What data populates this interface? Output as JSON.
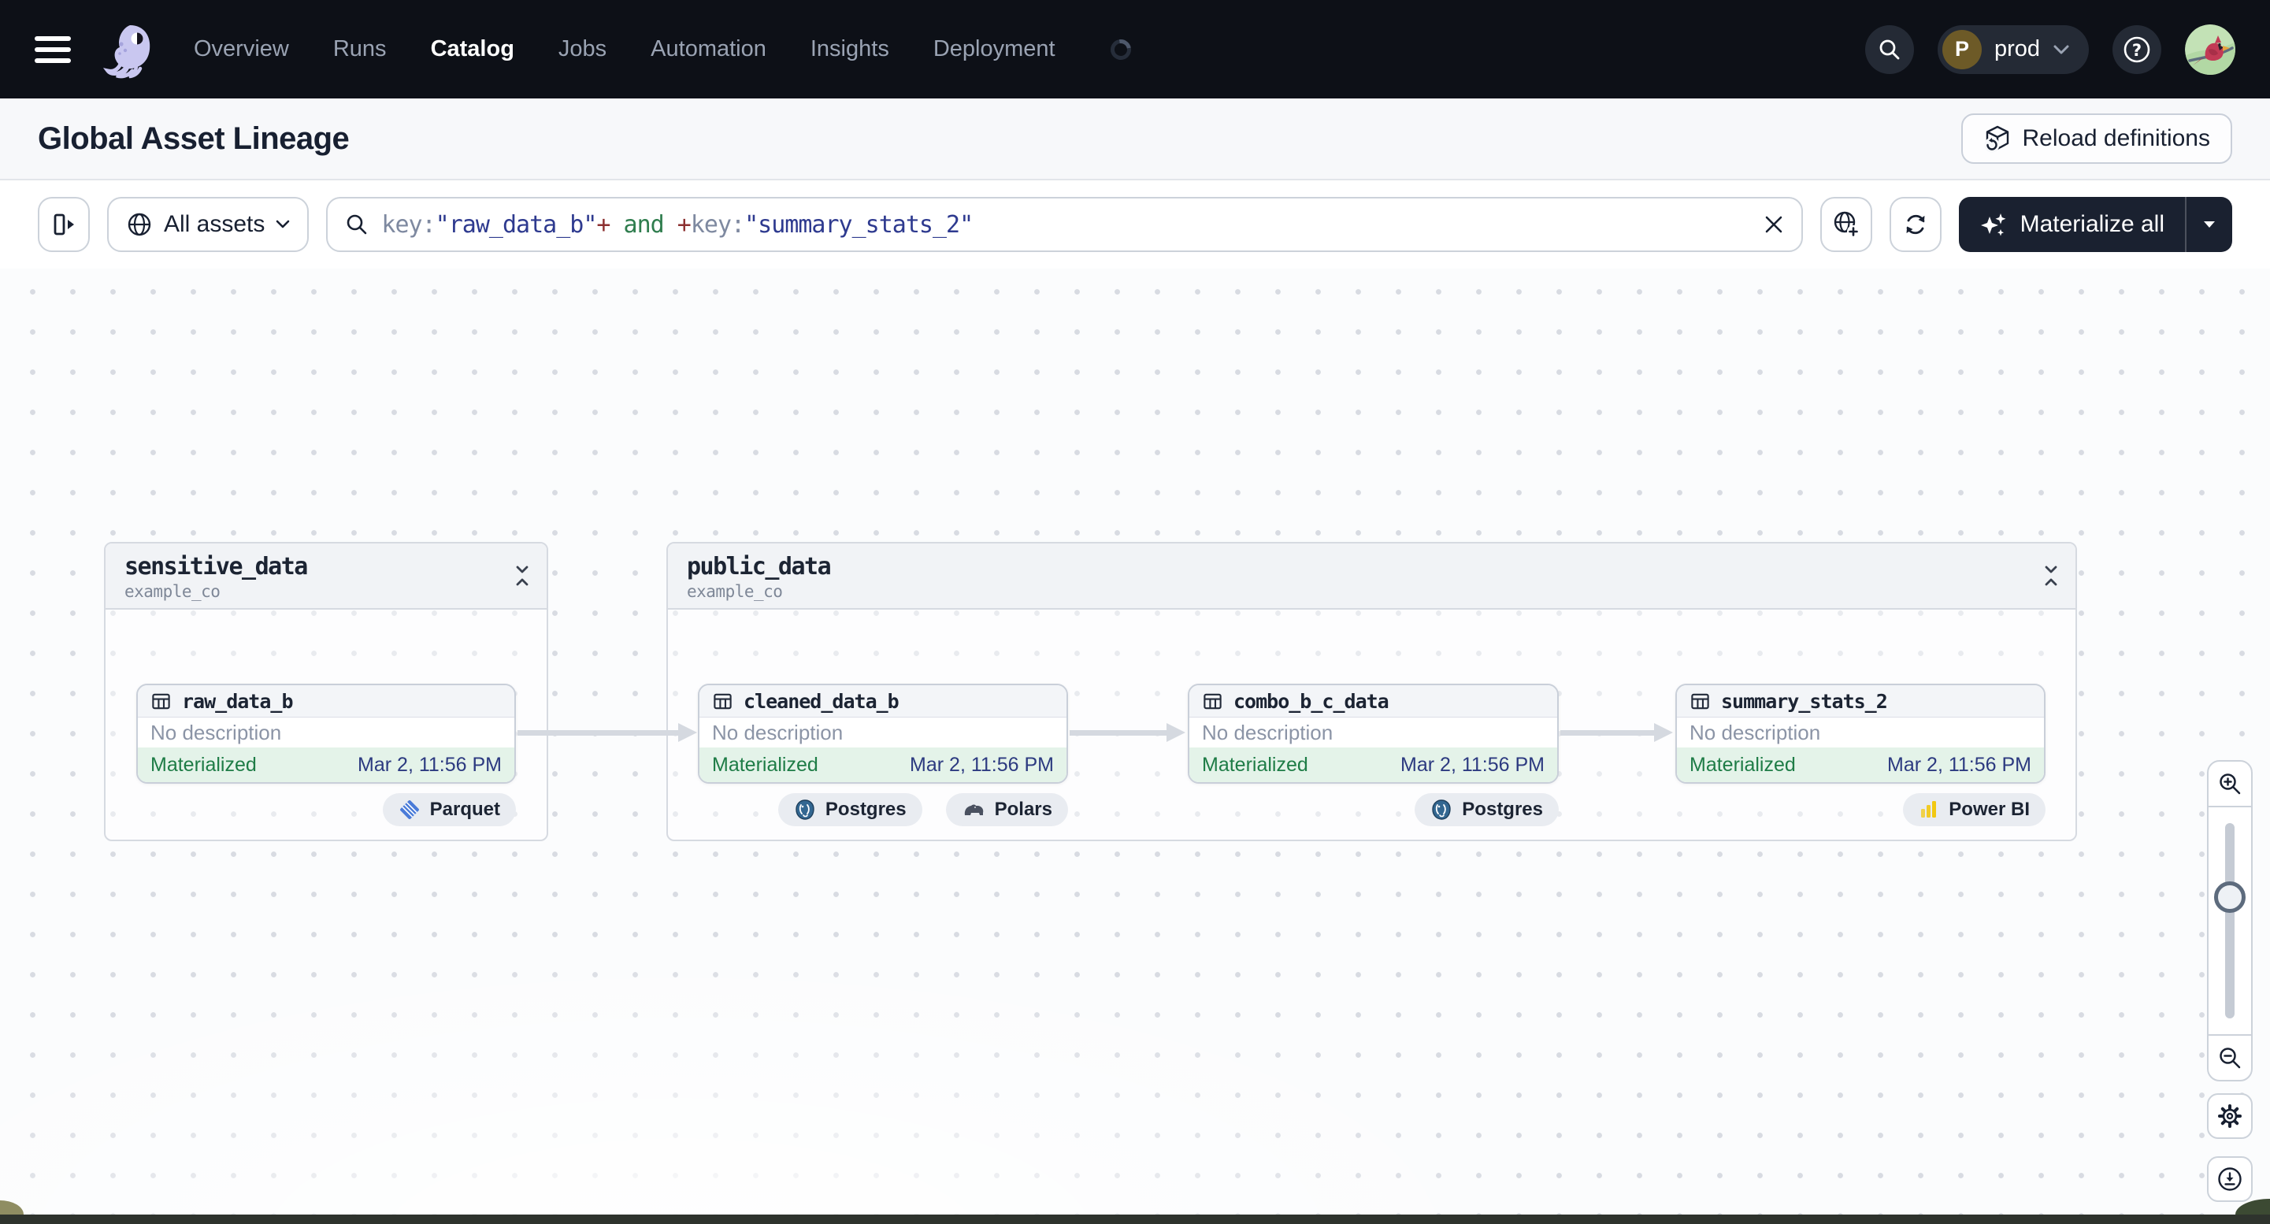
{
  "nav": {
    "menu_items": [
      {
        "label": "Overview",
        "active": false
      },
      {
        "label": "Runs",
        "active": false
      },
      {
        "label": "Catalog",
        "active": true
      },
      {
        "label": "Jobs",
        "active": false
      },
      {
        "label": "Automation",
        "active": false
      },
      {
        "label": "Insights",
        "active": false
      },
      {
        "label": "Deployment",
        "active": false
      }
    ],
    "workspace": {
      "initial": "P",
      "name": "prod"
    }
  },
  "header": {
    "title": "Global Asset Lineage",
    "reload_button": "Reload definitions"
  },
  "toolbar": {
    "scope_label": "All assets",
    "materialize_label": "Materialize all",
    "query_tokens": [
      {
        "text": "key:",
        "color": "#7e89a0"
      },
      {
        "text": "\"raw_data_b\"",
        "color": "#2e3a8f"
      },
      {
        "text": "+",
        "color": "#8c3030"
      },
      {
        "text": " and ",
        "color": "#2f7d4e"
      },
      {
        "text": "+",
        "color": "#8c3030"
      },
      {
        "text": "key:",
        "color": "#7e89a0"
      },
      {
        "text": "\"summary_stats_2\"",
        "color": "#2e3a8f"
      }
    ]
  },
  "lineage": {
    "groups": [
      {
        "name": "sensitive_data",
        "location": "example_co"
      },
      {
        "name": "public_data",
        "location": "example_co"
      }
    ],
    "nodes": [
      {
        "name": "raw_data_b",
        "description": "No description",
        "status": "Materialized",
        "materialized_at": "Mar 2, 11:56 PM",
        "tags": [
          "Parquet"
        ]
      },
      {
        "name": "cleaned_data_b",
        "description": "No description",
        "status": "Materialized",
        "materialized_at": "Mar 2, 11:56 PM",
        "tags": [
          "Postgres",
          "Polars"
        ]
      },
      {
        "name": "combo_b_c_data",
        "description": "No description",
        "status": "Materialized",
        "materialized_at": "Mar 2, 11:56 PM",
        "tags": [
          "Postgres"
        ]
      },
      {
        "name": "summary_stats_2",
        "description": "No description",
        "status": "Materialized",
        "materialized_at": "Mar 2, 11:56 PM",
        "tags": [
          "Power BI"
        ]
      }
    ]
  },
  "colors": {
    "nav_bg": "#0d1017",
    "accent_dark": "#1a2130",
    "status_green_bg": "#e4f3e9",
    "status_green_text": "#1e7c46",
    "timestamp_navy": "#2c3a80",
    "canvas_dot": "#d8dbe2",
    "border": "#ccd2da"
  }
}
